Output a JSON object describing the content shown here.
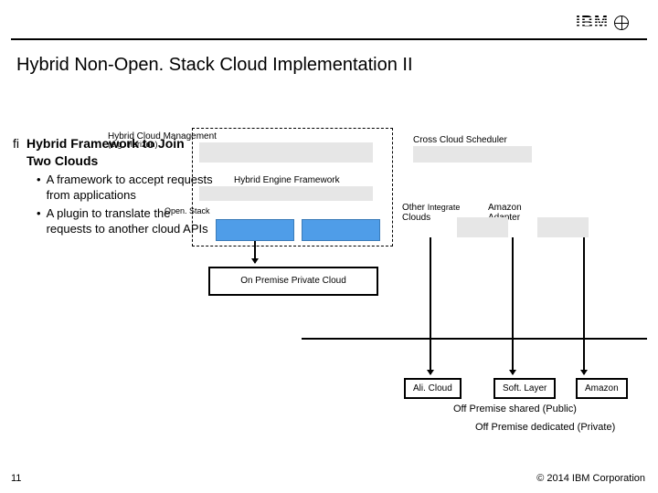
{
  "logo": {
    "text": "IBM"
  },
  "title": "Hybrid Non-Open. Stack Cloud Implementation II",
  "bullets": {
    "marker": "ﬁ",
    "main_line1": "Hybrid Framework to Join",
    "main_line2": "Two Clouds",
    "sub1": "A framework to accept requests from applications",
    "sub2": "A plugin to translate the requests to another cloud APIs",
    "overlap_line1": "Hybrid Cloud Management",
    "overlap_line2": "(e.g. Horizon)"
  },
  "diagram": {
    "cross_cloud_scheduler": "Cross Cloud Scheduler",
    "hybrid_engine": "Hybrid Engine Framework",
    "openstack": "Open. Stack",
    "integrate_line1a": "Other",
    "integrate_line1b": "Integrate",
    "integrate_line2": "Clouds",
    "amazon_label_line1": "Amazon",
    "amazon_label_line2": "Adapter",
    "on_premise": "On Premise Private Cloud",
    "alicloud": "Ali. Cloud",
    "softlayer": "Soft. Layer",
    "amazon": "Amazon",
    "off_premise_pub": "Off Premise shared (Public)",
    "off_premise_priv": "Off Premise dedicated (Private)"
  },
  "footer": {
    "page": "11",
    "copyright": "© 2014 IBM Corporation"
  }
}
